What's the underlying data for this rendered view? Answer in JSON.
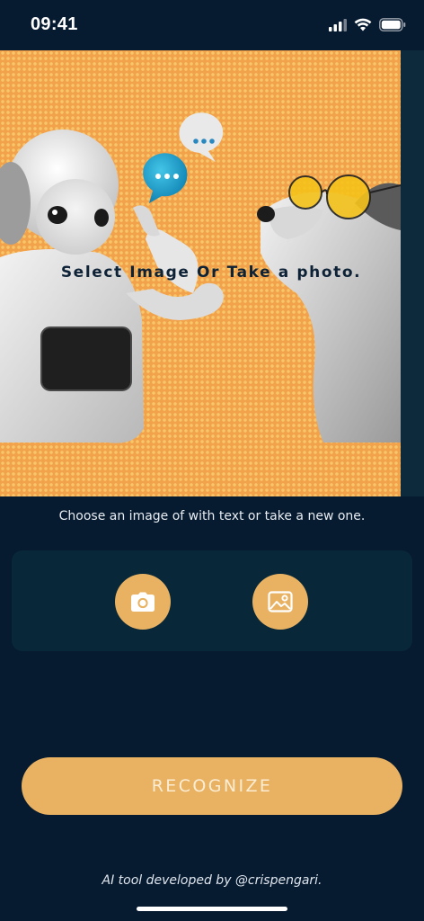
{
  "status_bar": {
    "time": "09:41",
    "icons": [
      "cellular-signal-icon",
      "wifi-icon",
      "battery-icon"
    ]
  },
  "hero": {
    "caption": "Select Image Or Take a photo."
  },
  "hint_text": "Choose an image of with text or take a new one.",
  "picker": {
    "camera_icon": "camera-icon",
    "gallery_icon": "gallery-icon"
  },
  "recognize_label": "RECOGNIZE",
  "footer_text": "AI tool developed by @crispengari.",
  "colors": {
    "background": "#061a30",
    "card": "#08283a",
    "accent": "#e9b262",
    "hero_orange": "#f2a24a"
  }
}
